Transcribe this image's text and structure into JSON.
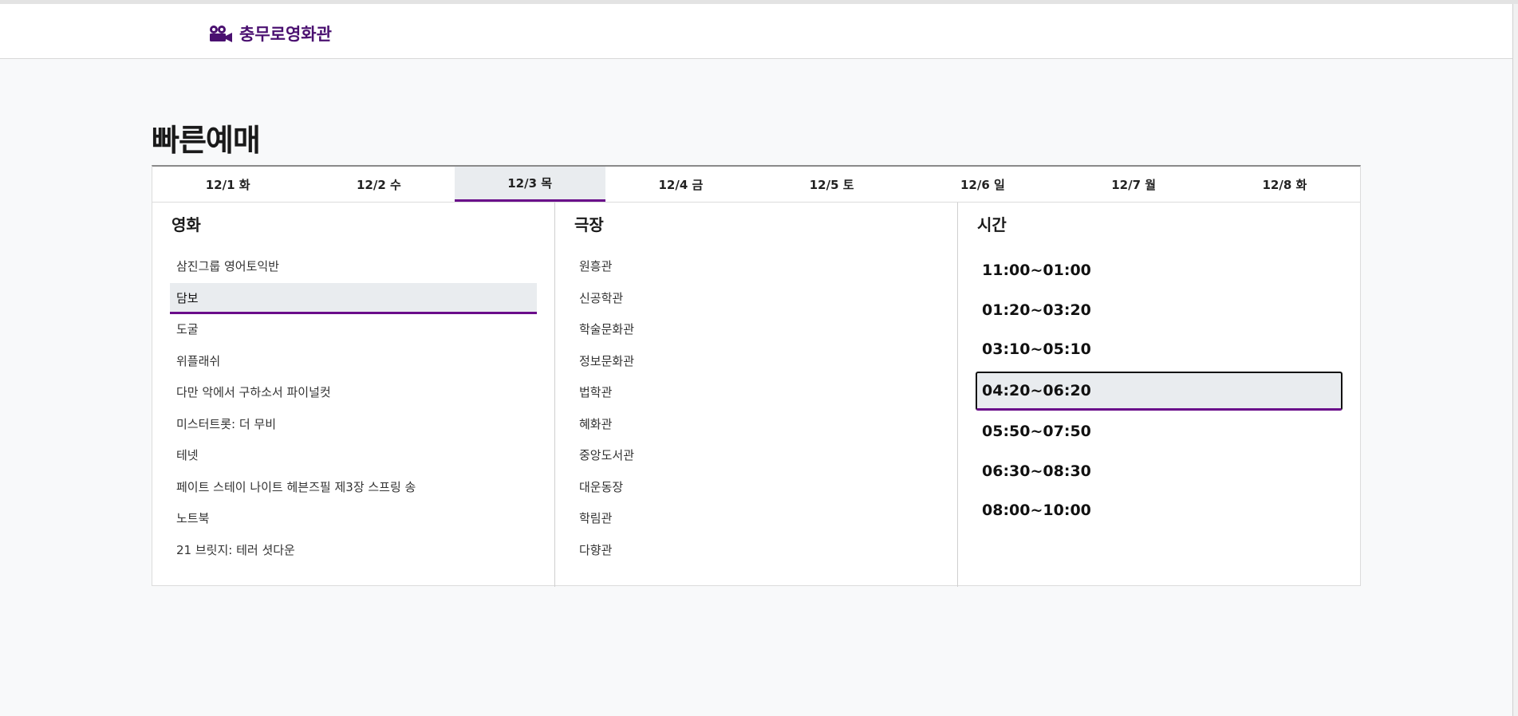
{
  "header": {
    "brand_icon": "movie-camera-icon",
    "brand_name": "충무로영화관",
    "brand_color": "#4a1070"
  },
  "page": {
    "title": "빠른예매"
  },
  "dates": [
    {
      "label": "12/1 화"
    },
    {
      "label": "12/2 수"
    },
    {
      "label": "12/3 목",
      "selected": true
    },
    {
      "label": "12/4 금"
    },
    {
      "label": "12/5 토"
    },
    {
      "label": "12/6 일"
    },
    {
      "label": "12/7 월"
    },
    {
      "label": "12/8 화"
    }
  ],
  "movies": {
    "heading": "영화",
    "items": [
      {
        "label": "삼진그룹 영어토익반"
      },
      {
        "label": "담보",
        "selected": true
      },
      {
        "label": "도굴"
      },
      {
        "label": "위플래쉬"
      },
      {
        "label": "다만 악에서 구하소서 파이널컷"
      },
      {
        "label": "미스터트롯: 더 무비"
      },
      {
        "label": "테넷"
      },
      {
        "label": "페이트 스테이 나이트 헤븐즈필 제3장 스프링 송"
      },
      {
        "label": "노트북"
      },
      {
        "label": "21 브릿지: 테러 셧다운"
      }
    ]
  },
  "theaters": {
    "heading": "극장",
    "items": [
      {
        "label": "원흥관"
      },
      {
        "label": "신공학관"
      },
      {
        "label": "학술문화관"
      },
      {
        "label": "정보문화관"
      },
      {
        "label": "법학관"
      },
      {
        "label": "혜화관"
      },
      {
        "label": "중앙도서관"
      },
      {
        "label": "대운동장"
      },
      {
        "label": "학림관"
      },
      {
        "label": "다향관"
      }
    ]
  },
  "times": {
    "heading": "시간",
    "items": [
      {
        "label": "11:00~01:00"
      },
      {
        "label": "01:20~03:20"
      },
      {
        "label": "03:10~05:10"
      },
      {
        "label": "04:20~06:20",
        "selected": true
      },
      {
        "label": "05:50~07:50"
      },
      {
        "label": "06:30~08:30"
      },
      {
        "label": "08:00~10:00"
      }
    ]
  },
  "colors": {
    "accent": "#6a0c8a",
    "selected_bg": "#e9ecef"
  }
}
